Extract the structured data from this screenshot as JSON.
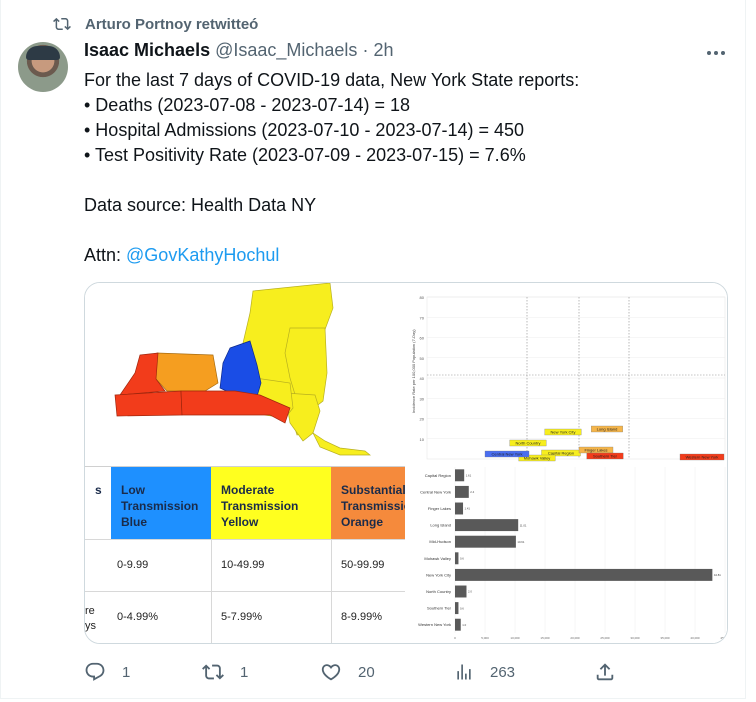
{
  "retweet": {
    "label": "Arturo Portnoy retwitteó",
    "icon": "retweet-icon"
  },
  "author": {
    "name": "Isaac Michaels",
    "handle": "@Isaac_Michaels",
    "separator": "·",
    "time": "2h"
  },
  "tweet": {
    "lines": [
      "For the last 7 days of COVID-19 data, New York State reports:",
      "• Deaths (2023-07-08 - 2023-07-14) = 18",
      "• Hospital Admissions (2023-07-10 - 2023-07-14) = 450",
      "• Test Positivity Rate (2023-07-09 - 2023-07-15) = 7.6%",
      "",
      "Data source: Health Data NY",
      ""
    ],
    "attn_prefix": "Attn: ",
    "mention": "@GovKathyHochul"
  },
  "media": {
    "map": {
      "regions": [
        "North Country",
        "Mohawk Valley",
        "Capital Region",
        "Mid-Hudson",
        "Finger Lakes",
        "Western New York",
        "Central New York",
        "Southern Tier"
      ],
      "colors": {
        "red": "#f23c1b",
        "orange": "#f59e20",
        "yellow": "#f7ee1e",
        "blue": "#1a4de6"
      }
    },
    "table": {
      "headers": [
        {
          "text": "s",
          "color": "#ffffff"
        },
        {
          "text": "Low Transmission Blue",
          "color": "#1e90ff"
        },
        {
          "text": "Moderate Transmission Yellow",
          "color": "#ffff1f"
        },
        {
          "text": "Substantial Transmission Orange",
          "color": "#f58a3c"
        }
      ],
      "rows": [
        [
          "",
          "0-9.99",
          "10-49.99",
          "50-99.99"
        ],
        [
          "re\nys",
          "0-4.99%",
          "5-7.99%",
          "8-9.99%"
        ]
      ]
    },
    "scatter": {
      "ylabel": "Incidence Rate per 100,000 Population (7-Day)",
      "yticks": [
        "80",
        "70",
        "60",
        "50",
        "40",
        "30",
        "20",
        "10"
      ],
      "labels": [
        {
          "text": "Long Island",
          "color": "#f5b54a"
        },
        {
          "text": "New York City",
          "color": "#f7ee1e"
        },
        {
          "text": "North Country",
          "color": "#f7ee1e"
        },
        {
          "text": "Capital Region",
          "color": "#f7ee1e"
        },
        {
          "text": "Mohawk Valley",
          "color": "#f7ee1e"
        },
        {
          "text": "Central New York",
          "color": "#4a6ef0"
        },
        {
          "text": "Finger Lakes",
          "color": "#f5b54a"
        },
        {
          "text": "Southern Tier",
          "color": "#f23c1b"
        },
        {
          "text": "Western New York",
          "color": "#f23c1b"
        }
      ]
    },
    "bar_chart": {
      "categories": [
        "Capital Region",
        "Central New York",
        "Finger Lakes",
        "Long Island",
        "Mid-Hudson",
        "Mohawk Valley",
        "New York City",
        "North Country",
        "Southern Tier",
        "Western New York"
      ],
      "values": [
        1.6,
        2.4,
        1.4,
        11.0,
        10.6,
        0.6,
        44.8,
        2.0,
        0.6,
        1.0
      ],
      "value_labels": [
        "1.61",
        "2.4",
        "1.41",
        "11.01",
        "10.61",
        "0.6",
        "44.81",
        "2.0",
        "0.6",
        "1.0"
      ],
      "xticks": [
        "0",
        "5,000",
        "10,000",
        "15,000",
        "20,000",
        "25,000",
        "30,000",
        "35,000",
        "40,000",
        "45,000"
      ],
      "xlim": [
        0,
        47
      ],
      "bar_color": "#595959"
    }
  },
  "actions": {
    "reply": {
      "count": "1",
      "icon": "reply-icon"
    },
    "retweet": {
      "count": "1",
      "icon": "retweet-icon"
    },
    "like": {
      "count": "20",
      "icon": "heart-icon"
    },
    "views": {
      "count": "263",
      "icon": "views-icon"
    },
    "share": {
      "icon": "share-icon"
    }
  }
}
